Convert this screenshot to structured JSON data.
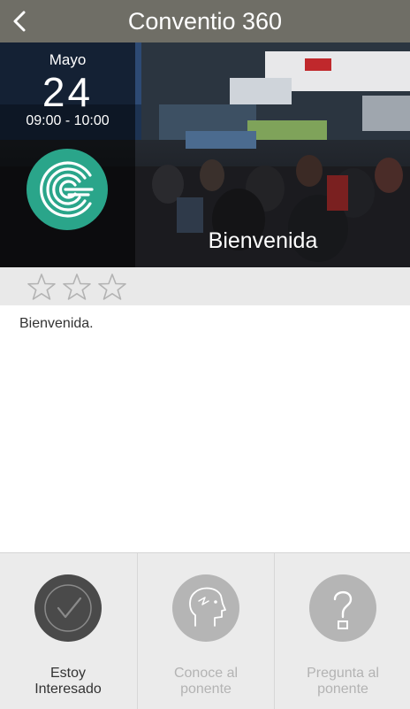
{
  "header": {
    "title": "Conventio 360",
    "back_icon": "chevron-left-icon"
  },
  "event": {
    "month": "Mayo",
    "day": "24",
    "time": "09:00 - 10:00",
    "title": "Bienvenida",
    "description": "Bienvenida.",
    "rating": {
      "value": 0,
      "max": 3
    }
  },
  "actions": [
    {
      "label_line1": "Estoy",
      "label_line2": "Interesado",
      "icon": "check-icon"
    },
    {
      "label_line1": "Conoce al",
      "label_line2": "ponente",
      "icon": "speaker-face-icon"
    },
    {
      "label_line1": "Pregunta al",
      "label_line2": "ponente",
      "icon": "question-icon"
    }
  ],
  "colors": {
    "topbar": "#6f6e66",
    "logo": "#2aa58a",
    "active_circle": "#4a4a4a",
    "inactive_circle": "#b5b5b5",
    "active_text": "#333333",
    "inactive_text": "#b3b3b3"
  }
}
